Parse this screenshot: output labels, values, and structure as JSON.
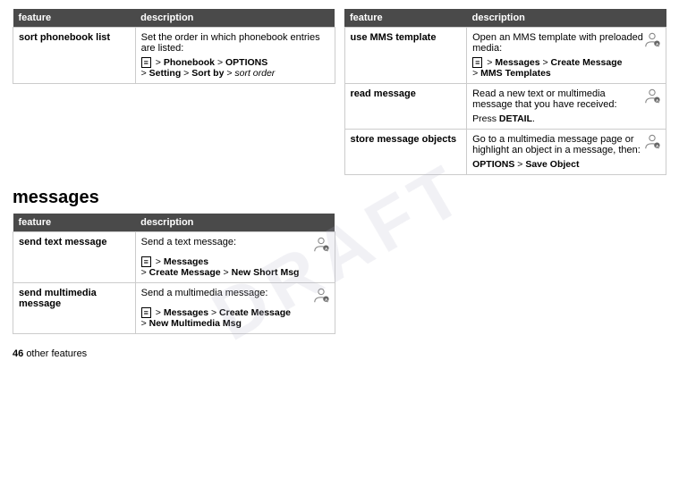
{
  "phonebook_table": {
    "headers": [
      "feature",
      "description"
    ],
    "rows": [
      {
        "feature": "sort phonebook list",
        "description_text": "Set the order in which phonebook entries are listed:",
        "menu_path": [
          {
            "type": "icon",
            "label": "≡"
          },
          {
            "type": "text",
            "label": " > "
          },
          {
            "type": "bold",
            "label": "Phonebook"
          },
          {
            "type": "text",
            "label": " > "
          },
          {
            "type": "bold",
            "label": "OPTIONS"
          },
          {
            "type": "text",
            "label": "\n> "
          },
          {
            "type": "bold",
            "label": "Setting"
          },
          {
            "type": "text",
            "label": " > "
          },
          {
            "type": "bold",
            "label": "Sort by"
          },
          {
            "type": "text",
            "label": " > "
          },
          {
            "type": "italic",
            "label": "sort order"
          }
        ]
      }
    ]
  },
  "messages_header": "messages",
  "messages_table": {
    "headers": [
      "feature",
      "description"
    ],
    "rows": [
      {
        "feature": "send text message",
        "description_text": "Send a text message:",
        "has_icon": true,
        "menu_path": "≡ > Messages\n> Create Message > New Short Msg"
      },
      {
        "feature": "send multimedia message",
        "description_text": "Send a multimedia message:",
        "has_icon": true,
        "menu_path": "≡ > Messages > Create Message\n> New Multimedia Msg"
      }
    ]
  },
  "right_table": {
    "headers": [
      "feature",
      "description"
    ],
    "rows": [
      {
        "feature": "use MMS template",
        "description_text": "Open an MMS template with preloaded media:",
        "has_icon": true,
        "menu_path": "≡ > Messages > Create Message\n> MMS Templates"
      },
      {
        "feature": "read message",
        "description_text": "Read a new text or multimedia message that you have received:",
        "has_icon": true,
        "menu_path_special": "Press DETAIL."
      },
      {
        "feature": "store message objects",
        "description_text": "Go to a multimedia message page or highlight an object in a message, then:",
        "has_icon": true,
        "menu_path": "OPTIONS > Save Object"
      }
    ]
  },
  "footer": {
    "page_number": "46",
    "section": "other features"
  }
}
